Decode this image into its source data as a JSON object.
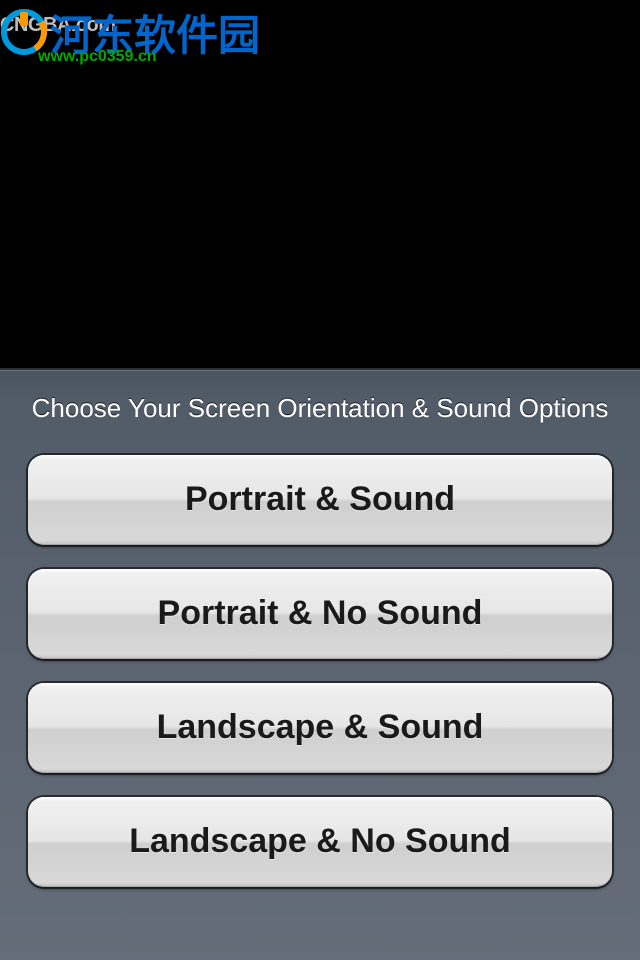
{
  "watermark": {
    "brand": "河东软件园",
    "url": "www.pc0359.cn",
    "corner": "CNGBA.com"
  },
  "sheet": {
    "title": "Choose Your Screen Orientation & Sound Options",
    "buttons": [
      {
        "label": "Portrait & Sound"
      },
      {
        "label": "Portrait & No Sound"
      },
      {
        "label": "Landscape & Sound"
      },
      {
        "label": "Landscape & No Sound"
      }
    ]
  }
}
